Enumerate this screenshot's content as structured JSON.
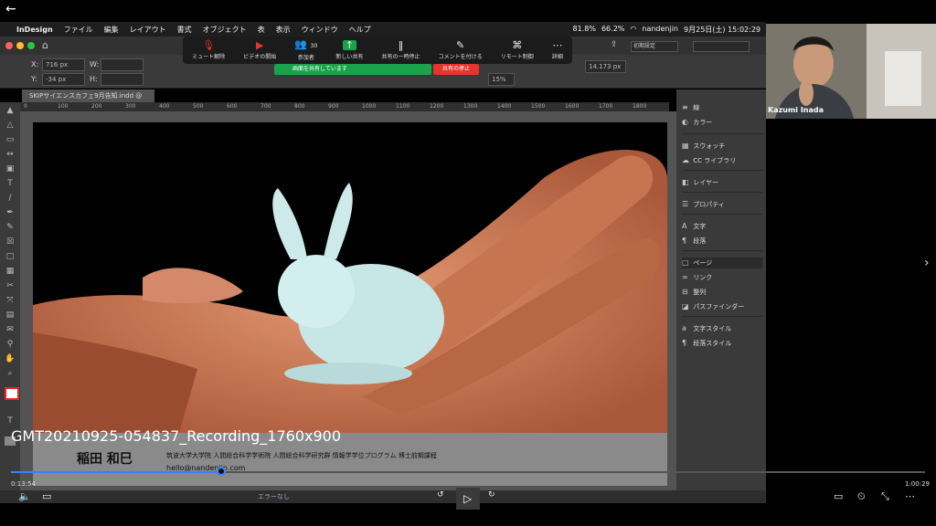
{
  "mac_menubar": {
    "items": [
      "InDesign",
      "ファイル",
      "編集",
      "レイアウト",
      "書式",
      "オブジェクト",
      "表",
      "表示",
      "ウィンドウ",
      "ヘルプ"
    ],
    "status": [
      "81.8%",
      "66.2%",
      "nandenjin",
      "9月25日(土) 15:02:29"
    ]
  },
  "zoom_toolbar": {
    "buttons": [
      {
        "label": "ミュート解除",
        "icon": "mic-muted-icon"
      },
      {
        "label": "ビデオの開始",
        "icon": "video-off-icon"
      },
      {
        "label": "参加者",
        "icon": "participants-icon",
        "count": "30"
      },
      {
        "label": "新しい共有",
        "icon": "new-share-icon"
      },
      {
        "label": "共有の一時停止",
        "icon": "pause-share-icon"
      },
      {
        "label": "コメントを付ける",
        "icon": "annotate-icon"
      },
      {
        "label": "リモート制御",
        "icon": "remote-control-icon"
      },
      {
        "label": "詳細",
        "icon": "more-icon"
      }
    ],
    "share_banner": "画面を共有しています",
    "stop_share": "共有の停止"
  },
  "control_panel": {
    "x": "716 px",
    "y": "-34 px",
    "w": "",
    "h": "",
    "stroke": "14.173 px",
    "zoom": "15%",
    "workspace": "初期設定"
  },
  "document": {
    "tab_title": "SKIPサイエンスカフェ9月告知.indd @ 35%",
    "ruler": [
      "0",
      "100",
      "200",
      "300",
      "400",
      "500",
      "600",
      "700",
      "800",
      "900",
      "1000",
      "1100",
      "1200",
      "1300",
      "1400",
      "1500",
      "1600",
      "1700",
      "1800"
    ]
  },
  "slide": {
    "name": "稲田 和巳",
    "affiliation": "筑波大学大学院 人間総合科学学術院 人間総合科学研究群 情報学学位プログラム 博士前期課程",
    "email": "hello@nandenjin.com"
  },
  "panels": [
    {
      "label": "線",
      "icon": "stroke-icon"
    },
    {
      "label": "カラー",
      "icon": "color-icon"
    },
    {
      "label": "スウォッチ",
      "icon": "swatches-icon"
    },
    {
      "label": "CC ライブラリ",
      "icon": "cc-libraries-icon"
    },
    {
      "label": "レイヤー",
      "icon": "layers-icon"
    },
    {
      "label": "プロパティ",
      "icon": "properties-icon"
    },
    {
      "label": "文字",
      "icon": "character-icon"
    },
    {
      "label": "段落",
      "icon": "paragraph-icon"
    },
    {
      "label": "ページ",
      "icon": "pages-icon"
    },
    {
      "label": "リンク",
      "icon": "links-icon"
    },
    {
      "label": "整列",
      "icon": "align-icon"
    },
    {
      "label": "パスファインダー",
      "icon": "pathfinder-icon"
    },
    {
      "label": "文字スタイル",
      "icon": "char-styles-icon"
    },
    {
      "label": "段落スタイル",
      "icon": "para-styles-icon"
    }
  ],
  "participant": {
    "name": "Kazumi Inada"
  },
  "player": {
    "title": "GMT20210925-054837_Recording_1760x900",
    "current_time": "0:13:54",
    "total_time": "1:00:29",
    "progress": 0.23,
    "preflight": "エラーなし"
  }
}
